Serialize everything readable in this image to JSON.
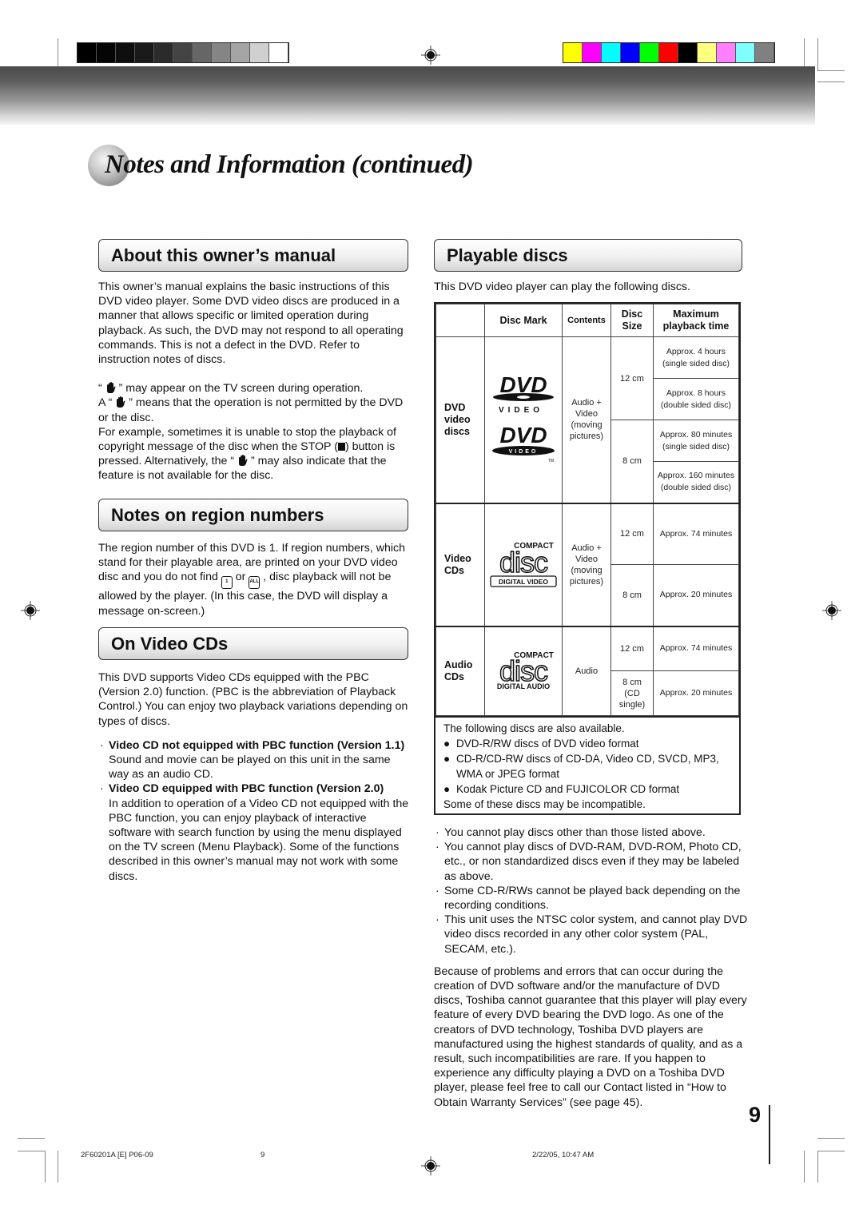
{
  "colors": {
    "gray_bars": [
      "#000000",
      "#050505",
      "#0e0e0e",
      "#1a1a1a",
      "#2b2b2b",
      "#444444",
      "#666666",
      "#858585",
      "#a5a5a5",
      "#d0d0d0",
      "#ffffff"
    ],
    "color_bars": [
      "#ffff00",
      "#ff00ff",
      "#00ffff",
      "#0000ff",
      "#00ff00",
      "#ff0000",
      "#000000",
      "#ffff80",
      "#ff80ff",
      "#80ffff",
      "#808080"
    ]
  },
  "page_title": "Notes and Information (continued)",
  "left": {
    "about": {
      "heading": "About this owner’s manual",
      "para1": "This owner’s manual explains the basic instructions of this DVD video player. Some DVD video discs are produced in a manner that allows specific or limited operation during playback. As such, the DVD may not respond to all operating commands. This is not a defect in the DVD. Refer to instruction notes of discs.",
      "line1_pre": "“ ",
      "line1_post": " ” may appear on the TV screen during operation.",
      "line2_pre": "A “ ",
      "line2_post": " ” means that the operation is not permitted by the DVD or the disc.",
      "line3_pre": "For example, sometimes it is unable to stop the playback of copyright message of the disc when the STOP (",
      "line3_mid": ") button is pressed. Alternatively, the “ ",
      "line3_post": " ” may also indicate that the feature is not available for the disc."
    },
    "region": {
      "heading": "Notes on region numbers",
      "text_pre": "The region number of this DVD is 1. If region numbers, which stand for their playable area, are printed on your DVD video disc and you do not find ",
      "icon1_label": "1",
      "text_or": " or ",
      "icon2_label": "ALL",
      "text_post": " , disc playback will not be allowed by the player. (In this case, the DVD will display a message on-screen.)"
    },
    "vcd": {
      "heading": "On Video CDs",
      "intro": "This DVD supports Video CDs equipped with the PBC (Version 2.0) function. (PBC is the abbreviation of Playback Control.) You can enjoy two playback variations depending on types of discs.",
      "items": [
        {
          "title": "Video CD not equipped with PBC function (Version 1.1)",
          "body": "Sound and movie can be played on this unit in the same way as an audio CD."
        },
        {
          "title": "Video CD equipped with PBC function (Version 2.0)",
          "body": "In addition to operation of a Video CD not equipped with the PBC function, you can enjoy playback of interactive software with search function by using the menu displayed on the TV screen (Menu Playback). Some of the functions described in this owner’s manual may not work with some discs."
        }
      ]
    }
  },
  "right": {
    "heading": "Playable discs",
    "intro": "This DVD video player can play the following discs.",
    "table": {
      "headers": [
        "",
        "Disc Mark",
        "Contents",
        "Disc Size",
        "Maximum playback time"
      ],
      "rows": [
        {
          "type": "DVD video discs",
          "mark": "DVD VIDEO",
          "contents": "Audio + Video (moving pictures)",
          "sizes": [
            {
              "size": "12 cm",
              "times": [
                "Approx. 4 hours (single sided disc)",
                "Approx. 8 hours (double sided disc)"
              ]
            },
            {
              "size": "8 cm",
              "times": [
                "Approx. 80 minutes (single sided disc)",
                "Approx. 160 minutes (double sided disc)"
              ]
            }
          ]
        },
        {
          "type": "Video CDs",
          "mark": "COMPACT disc DIGITAL VIDEO",
          "contents": "Audio + Video (moving pictures)",
          "sizes": [
            {
              "size": "12 cm",
              "times": [
                "Approx. 74 minutes"
              ]
            },
            {
              "size": "8 cm",
              "times": [
                "Approx. 20 minutes"
              ]
            }
          ]
        },
        {
          "type": "Audio CDs",
          "mark": "COMPACT disc DIGITAL AUDIO",
          "contents": "Audio",
          "sizes": [
            {
              "size": "12 cm",
              "times": [
                "Approx. 74 minutes"
              ]
            },
            {
              "size": "8 cm (CD single)",
              "times": [
                "Approx. 20 minutes"
              ]
            }
          ]
        }
      ]
    },
    "also": {
      "intro": "The following discs are also available.",
      "items": [
        "DVD-R/RW discs of DVD video format",
        "CD-R/CD-RW discs of CD-DA, Video CD, SVCD, MP3, WMA or JPEG format",
        "Kodak Picture CD and FUJICOLOR CD format"
      ],
      "outro": "Some of these discs may be incompatible."
    },
    "notes": [
      "You cannot play discs other than those listed above.",
      "You cannot play discs of DVD-RAM, DVD-ROM, Photo CD, etc., or non standardized discs even if they may be labeled as above.",
      "Some CD-R/RWs cannot be played back depending on the recording conditions.",
      "This unit uses the NTSC color system, and cannot play DVD video discs recorded in any other color system (PAL, SECAM, etc.)."
    ],
    "closing": "Because of problems and errors that can occur during the creation of DVD software and/or the manufacture of DVD discs, Toshiba cannot guarantee that this player will play every feature of every DVD bearing the DVD logo.  As one of the creators of DVD technology, Toshiba DVD players are manufactured using the highest standards of quality, and as a result, such incompatibilities are rare.  If you happen to experience any difficulty playing a DVD on a Toshiba DVD player, please feel free to call our Contact listed in “How to Obtain Warranty Services” (see page 45)."
  },
  "page_number": "9",
  "footer": {
    "code": "2F60201A [E] P06-09",
    "sheet": "9",
    "datetime": "2/22/05, 10:47 AM"
  }
}
